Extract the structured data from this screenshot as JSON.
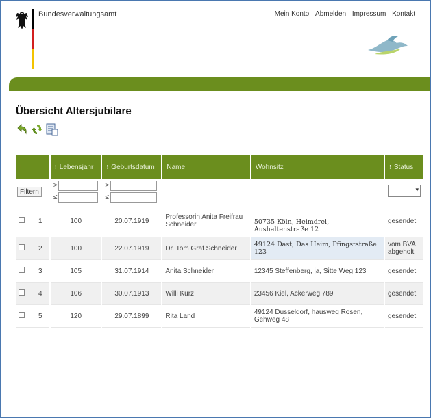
{
  "header": {
    "agency_name": "Bundesverwaltungsamt",
    "nav": [
      "Mein Konto",
      "Abmelden",
      "Impressum",
      "Kontakt"
    ]
  },
  "page": {
    "title": "Übersicht Altersjubilare"
  },
  "toolbar": {
    "icons": [
      "back-icon",
      "refresh-icon",
      "export-icon"
    ]
  },
  "table": {
    "columns": [
      "",
      "Lebensjahr",
      "Geburtsdatum",
      "Name",
      "Wohnsitz",
      "Status"
    ],
    "filter": {
      "button_label": "Filtern",
      "ge": "≥",
      "le": "≤"
    },
    "rows": [
      {
        "nr": "1",
        "age": "100",
        "birth": "20.07.1919",
        "name": "Professorin Anita Freifrau Schneider",
        "address": "50735 Köln, Heimdrei, Aushaltenstraße 12",
        "status": "gesendet"
      },
      {
        "nr": "2",
        "age": "100",
        "birth": "22.07.1919",
        "name": "Dr. Tom Graf Schneider",
        "address": "49124 Dast, Das Heim, Pfingststraße 123",
        "status": "vom BVA abgeholt"
      },
      {
        "nr": "3",
        "age": "105",
        "birth": "31.07.1914",
        "name": "Anita  Schneider",
        "address": "12345 Steffenberg, ja, Sitte Weg 123",
        "status": "gesendet"
      },
      {
        "nr": "4",
        "age": "106",
        "birth": "30.07.1913",
        "name": "Willi  Kurz",
        "address": "23456 Kiel, Ackerweg 789",
        "status": "gesendet"
      },
      {
        "nr": "5",
        "age": "120",
        "birth": "29.07.1899",
        "name": "Rita  Land",
        "address": "49124 Dusseldorf, hausweg Rosen, Gehweg 48",
        "status": "gesendet"
      }
    ]
  },
  "colors": {
    "brand_green": "#6b8e1e",
    "highlight_blue": "#e3ebf4"
  }
}
